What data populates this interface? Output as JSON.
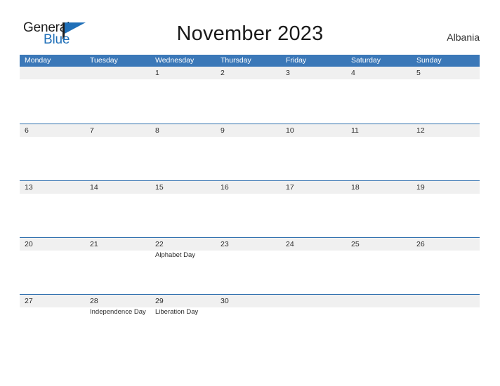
{
  "brand": {
    "logo_text_primary": "General",
    "logo_text_secondary": "Blue",
    "logo_icon": "flag-triangle-icon",
    "accent_color": "#1f6fb8"
  },
  "header": {
    "title": "November 2023",
    "country": "Albania"
  },
  "calendar": {
    "header_color": "#3b78b8",
    "stripe_color": "#f0f0f0",
    "row_border_color": "#2f6fae",
    "weekdays": [
      "Monday",
      "Tuesday",
      "Wednesday",
      "Thursday",
      "Friday",
      "Saturday",
      "Sunday"
    ],
    "weeks": [
      [
        {
          "day": ""
        },
        {
          "day": ""
        },
        {
          "day": "1",
          "events": []
        },
        {
          "day": "2",
          "events": []
        },
        {
          "day": "3",
          "events": []
        },
        {
          "day": "4",
          "events": []
        },
        {
          "day": "5",
          "events": []
        }
      ],
      [
        {
          "day": "6",
          "events": []
        },
        {
          "day": "7",
          "events": []
        },
        {
          "day": "8",
          "events": []
        },
        {
          "day": "9",
          "events": []
        },
        {
          "day": "10",
          "events": []
        },
        {
          "day": "11",
          "events": []
        },
        {
          "day": "12",
          "events": []
        }
      ],
      [
        {
          "day": "13",
          "events": []
        },
        {
          "day": "14",
          "events": []
        },
        {
          "day": "15",
          "events": []
        },
        {
          "day": "16",
          "events": []
        },
        {
          "day": "17",
          "events": []
        },
        {
          "day": "18",
          "events": []
        },
        {
          "day": "19",
          "events": []
        }
      ],
      [
        {
          "day": "20",
          "events": []
        },
        {
          "day": "21",
          "events": []
        },
        {
          "day": "22",
          "events": [
            "Alphabet Day"
          ]
        },
        {
          "day": "23",
          "events": []
        },
        {
          "day": "24",
          "events": []
        },
        {
          "day": "25",
          "events": []
        },
        {
          "day": "26",
          "events": []
        }
      ],
      [
        {
          "day": "27",
          "events": []
        },
        {
          "day": "28",
          "events": [
            "Independence Day"
          ]
        },
        {
          "day": "29",
          "events": [
            "Liberation Day"
          ]
        },
        {
          "day": "30",
          "events": []
        },
        {
          "day": ""
        },
        {
          "day": ""
        },
        {
          "day": ""
        }
      ]
    ]
  }
}
